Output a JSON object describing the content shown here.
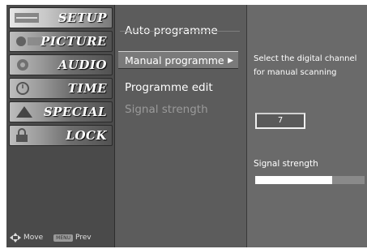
{
  "side_menu": {
    "items": [
      {
        "label": "SETUP",
        "icon": "setup-icon"
      },
      {
        "label": "PICTURE",
        "icon": "picture-icon"
      },
      {
        "label": "AUDIO",
        "icon": "audio-icon"
      },
      {
        "label": "TIME",
        "icon": "time-icon"
      },
      {
        "label": "SPECIAL",
        "icon": "special-icon"
      },
      {
        "label": "LOCK",
        "icon": "lock-icon"
      }
    ],
    "hint_move": "Move",
    "hint_prev_key": "MENU",
    "hint_prev": "Prev"
  },
  "submenu": {
    "items": [
      {
        "label": "Auto programme"
      },
      {
        "label": "Manual programme"
      },
      {
        "label": "Programme edit"
      },
      {
        "label": "Signal strength"
      }
    ],
    "selected_arrow": "▶"
  },
  "panel": {
    "description": "Select the digital channel for manual scanning",
    "channel": "7",
    "signal_label": "Signal strength",
    "signal_level": 0.7
  }
}
